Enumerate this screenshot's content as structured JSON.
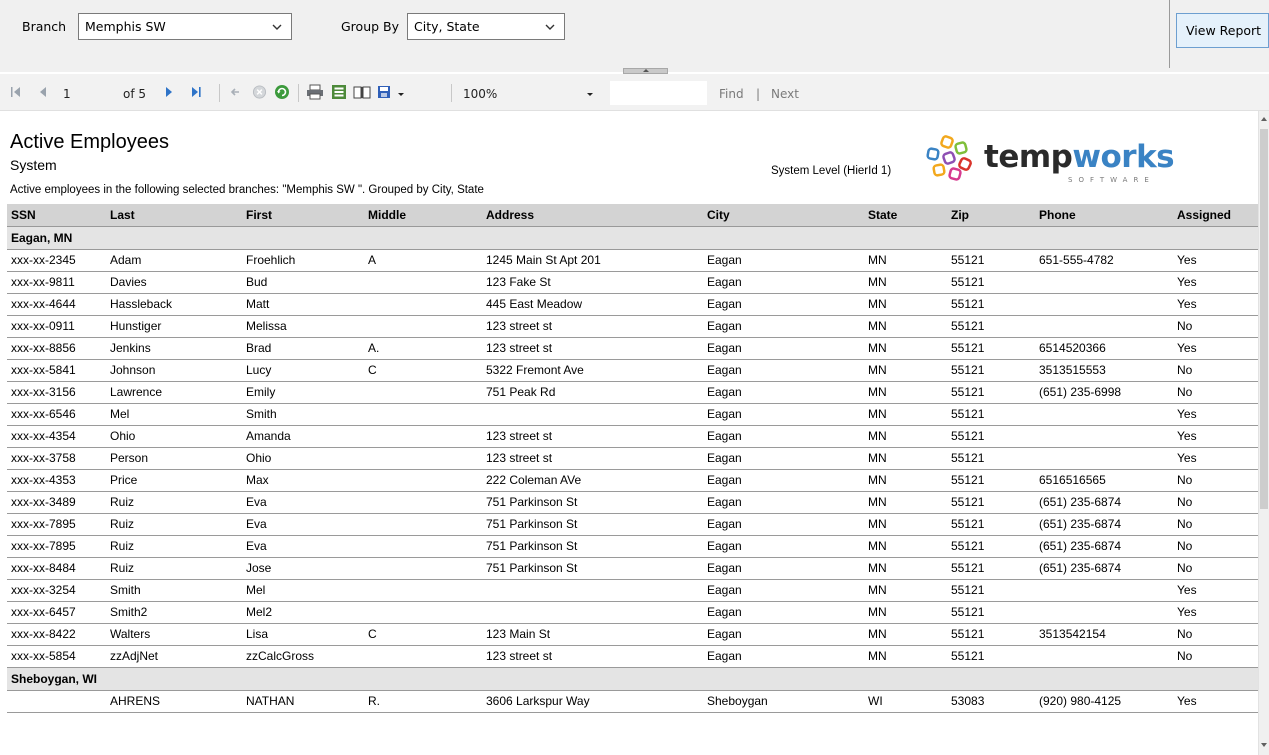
{
  "params": {
    "branch_label": "Branch",
    "branch_value": "Memphis SW",
    "groupby_label": "Group By",
    "groupby_value": "City, State",
    "view_report_label": "View Report"
  },
  "toolbar": {
    "page_current": "1",
    "page_of": "of 5",
    "zoom": "100%",
    "find_label": "Find",
    "find_sep": "|",
    "next_label": "Next"
  },
  "report": {
    "title": "Active Employees",
    "subtitle": "System",
    "description": "Active employees in the following selected branches: \"Memphis SW \". Grouped by City, State",
    "level": "System Level (HierId 1)",
    "logo_text_a": "temp",
    "logo_text_b": "works",
    "logo_sub": "SOFTWARE"
  },
  "columns": [
    "SSN",
    "Last",
    "First",
    "Middle",
    "Address",
    "City",
    "State",
    "Zip",
    "Phone",
    "Assigned"
  ],
  "groups": [
    {
      "name": "Eagan, MN",
      "rows": [
        [
          "xxx-xx-2345",
          "Adam",
          "Froehlich",
          "A",
          "1245 Main St  Apt 201",
          "Eagan",
          "MN",
          "55121",
          "651-555-4782",
          "Yes"
        ],
        [
          "xxx-xx-9811",
          "Davies",
          "Bud",
          "",
          "123 Fake St",
          "Eagan",
          "MN",
          "55121",
          "",
          "Yes"
        ],
        [
          "xxx-xx-4644",
          "Hassleback",
          "Matt",
          "",
          "445 East Meadow",
          "Eagan",
          "MN",
          "55121",
          "",
          "Yes"
        ],
        [
          "xxx-xx-0911",
          "Hunstiger",
          "Melissa",
          "",
          "123 street st",
          "Eagan",
          "MN",
          "55121",
          "",
          "No"
        ],
        [
          "xxx-xx-8856",
          "Jenkins",
          "Brad",
          "A.",
          "123 street st",
          "Eagan",
          "MN",
          "55121",
          "6514520366",
          "Yes"
        ],
        [
          "xxx-xx-5841",
          "Johnson",
          "Lucy",
          "C",
          "5322 Fremont Ave",
          "Eagan",
          "MN",
          "55121",
          "3513515553",
          "No"
        ],
        [
          "xxx-xx-3156",
          "Lawrence",
          "Emily",
          "",
          "751 Peak Rd",
          "Eagan",
          "MN",
          "55121",
          "(651) 235-6998",
          "No"
        ],
        [
          "xxx-xx-6546",
          "Mel",
          "Smith",
          "",
          "",
          "Eagan",
          "MN",
          "55121",
          "",
          "Yes"
        ],
        [
          "xxx-xx-4354",
          "Ohio",
          "Amanda",
          "",
          "123 street st",
          "Eagan",
          "MN",
          "55121",
          "",
          "Yes"
        ],
        [
          "xxx-xx-3758",
          "Person",
          "Ohio",
          "",
          "123 street st",
          "Eagan",
          "MN",
          "55121",
          "",
          "Yes"
        ],
        [
          "xxx-xx-4353",
          "Price",
          "Max",
          "",
          "222 Coleman AVe",
          "Eagan",
          "MN",
          "55121",
          "6516516565",
          "No"
        ],
        [
          "xxx-xx-3489",
          "Ruiz",
          "Eva",
          "",
          "751 Parkinson St",
          "Eagan",
          "MN",
          "55121",
          "(651) 235-6874",
          "No"
        ],
        [
          "xxx-xx-7895",
          "Ruiz",
          "Eva",
          "",
          "751 Parkinson St",
          "Eagan",
          "MN",
          "55121",
          "(651) 235-6874",
          "No"
        ],
        [
          "xxx-xx-7895",
          "Ruiz",
          "Eva",
          "",
          "751 Parkinson St",
          "Eagan",
          "MN",
          "55121",
          "(651) 235-6874",
          "No"
        ],
        [
          "xxx-xx-8484",
          "Ruiz",
          "Jose",
          "",
          "751 Parkinson St",
          "Eagan",
          "MN",
          "55121",
          "(651) 235-6874",
          "No"
        ],
        [
          "xxx-xx-3254",
          "Smith",
          "Mel",
          "",
          "",
          "Eagan",
          "MN",
          "55121",
          "",
          "Yes"
        ],
        [
          "xxx-xx-6457",
          "Smith2",
          "Mel2",
          "",
          "",
          "Eagan",
          "MN",
          "55121",
          "",
          "Yes"
        ],
        [
          "xxx-xx-8422",
          "Walters",
          "Lisa",
          "C",
          "123 Main St",
          "Eagan",
          "MN",
          "55121",
          "3513542154",
          "No"
        ],
        [
          "xxx-xx-5854",
          "zzAdjNet",
          "zzCalcGross",
          "",
          "123 street st",
          "Eagan",
          "MN",
          "55121",
          "",
          "No"
        ]
      ]
    },
    {
      "name": "Sheboygan, WI",
      "rows": [
        [
          "",
          "AHRENS",
          "NATHAN",
          "R.",
          "3606 Larkspur Way",
          "Sheboygan",
          "WI",
          "53083",
          "(920) 980-4125",
          "Yes"
        ]
      ]
    }
  ]
}
